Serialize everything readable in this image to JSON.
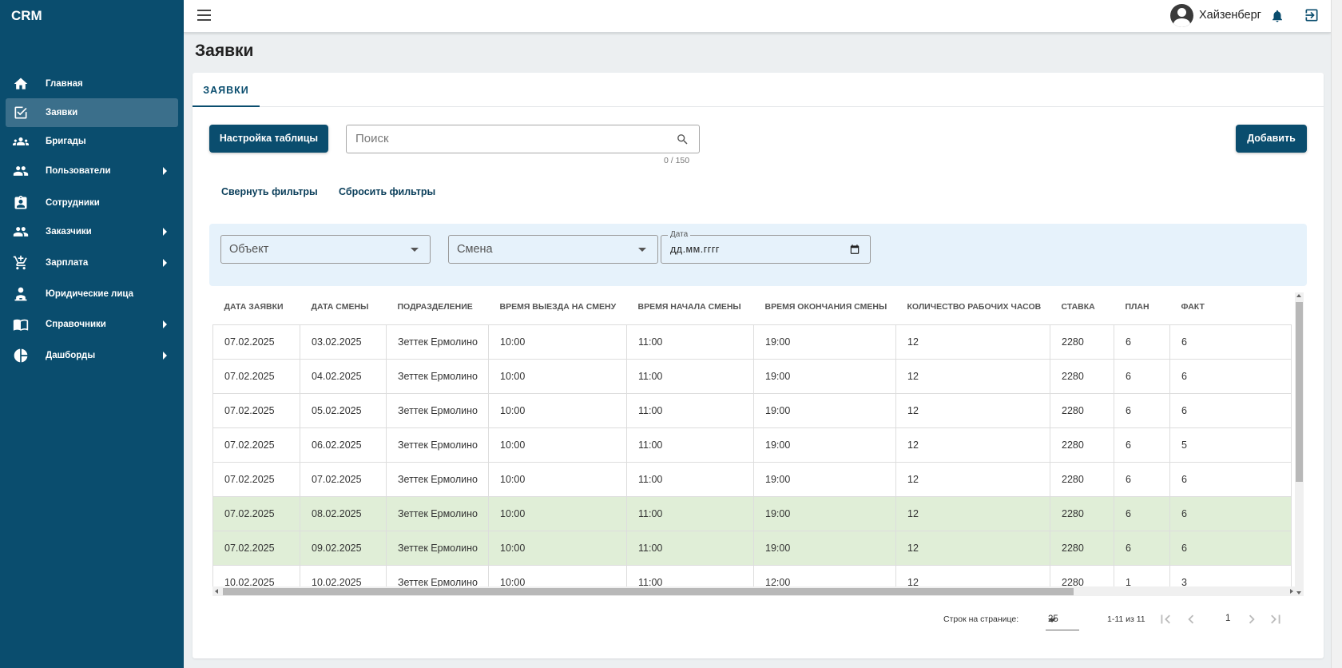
{
  "app": {
    "brand": "CRM"
  },
  "sidebar": {
    "items": [
      {
        "label": "Главная",
        "icon": "home-icon",
        "active": false,
        "has_children": false
      },
      {
        "label": "Заявки",
        "icon": "checkbox-icon",
        "active": true,
        "has_children": false
      },
      {
        "label": "Бригады",
        "icon": "group-icon",
        "active": false,
        "has_children": false
      },
      {
        "label": "Пользователи",
        "icon": "people-icon",
        "active": false,
        "has_children": true
      },
      {
        "label": "Сотрудники",
        "icon": "badge-icon",
        "active": false,
        "has_children": false
      },
      {
        "label": "Заказчики",
        "icon": "people-icon",
        "active": false,
        "has_children": true
      },
      {
        "label": "Зарплата",
        "icon": "cart-icon",
        "active": false,
        "has_children": true
      },
      {
        "label": "Юридические лица",
        "icon": "person-desk-icon",
        "active": false,
        "has_children": false
      },
      {
        "label": "Справочники",
        "icon": "book-icon",
        "active": false,
        "has_children": true
      },
      {
        "label": "Дашборды",
        "icon": "pie-chart-icon",
        "active": false,
        "has_children": true
      }
    ]
  },
  "header": {
    "user_name": "Хайзенберг"
  },
  "page": {
    "title": "Заявки"
  },
  "tabs": [
    {
      "label": "ЗАЯВКИ"
    }
  ],
  "toolbar": {
    "settings_label": "Настройка таблицы",
    "search_placeholder": "Поиск",
    "search_value": "",
    "search_counter": "0 / 150",
    "add_label": "Добавить",
    "collapse_filters": "Свернуть фильтры",
    "reset_filters": "Сбросить фильтры"
  },
  "filters": {
    "object_placeholder": "Объект",
    "shift_placeholder": "Смена",
    "date_label": "Дата",
    "date_value": "дд.мм.гггг"
  },
  "table": {
    "columns": [
      "ДАТА ЗАЯВКИ",
      "ДАТА СМЕНЫ",
      "ПОДРАЗДЕЛЕНИЕ",
      "ВРЕМЯ ВЫЕЗДА НА СМЕНУ",
      "ВРЕМЯ НАЧАЛА СМЕНЫ",
      "ВРЕМЯ ОКОНЧАНИЯ СМЕНЫ",
      "КОЛИЧЕСТВО РАБОЧИХ ЧАСОВ",
      "СТАВКА",
      "ПЛАН",
      "ФАКТ"
    ],
    "rows": [
      {
        "cells": [
          "07.02.2025",
          "03.02.2025",
          "Зеттек Ермолино",
          "10:00",
          "11:00",
          "19:00",
          "12",
          "2280",
          "6",
          "6"
        ],
        "highlight": false
      },
      {
        "cells": [
          "07.02.2025",
          "04.02.2025",
          "Зеттек Ермолино",
          "10:00",
          "11:00",
          "19:00",
          "12",
          "2280",
          "6",
          "6"
        ],
        "highlight": false
      },
      {
        "cells": [
          "07.02.2025",
          "05.02.2025",
          "Зеттек Ермолино",
          "10:00",
          "11:00",
          "19:00",
          "12",
          "2280",
          "6",
          "6"
        ],
        "highlight": false
      },
      {
        "cells": [
          "07.02.2025",
          "06.02.2025",
          "Зеттек Ермолино",
          "10:00",
          "11:00",
          "19:00",
          "12",
          "2280",
          "6",
          "5"
        ],
        "highlight": false
      },
      {
        "cells": [
          "07.02.2025",
          "07.02.2025",
          "Зеттек Ермолино",
          "10:00",
          "11:00",
          "19:00",
          "12",
          "2280",
          "6",
          "6"
        ],
        "highlight": false
      },
      {
        "cells": [
          "07.02.2025",
          "08.02.2025",
          "Зеттек Ермолино",
          "10:00",
          "11:00",
          "19:00",
          "12",
          "2280",
          "6",
          "6"
        ],
        "highlight": true
      },
      {
        "cells": [
          "07.02.2025",
          "09.02.2025",
          "Зеттек Ермолино",
          "10:00",
          "11:00",
          "19:00",
          "12",
          "2280",
          "6",
          "6"
        ],
        "highlight": true
      },
      {
        "cells": [
          "10.02.2025",
          "10.02.2025",
          "Зеттек Ермолино",
          "10:00",
          "11:00",
          "12:00",
          "12",
          "2280",
          "1",
          "3"
        ],
        "highlight": false
      }
    ]
  },
  "pagination": {
    "rows_per_page_label": "Строк на странице:",
    "rows_per_page": "25",
    "range": "1-11 из 11",
    "current_page": "1"
  },
  "colors": {
    "primary": "#0a4d6e",
    "sidebar_active": "#3b6f8b",
    "filter_bg": "#e6f2fb",
    "row_highlight": "#e0eed7"
  }
}
